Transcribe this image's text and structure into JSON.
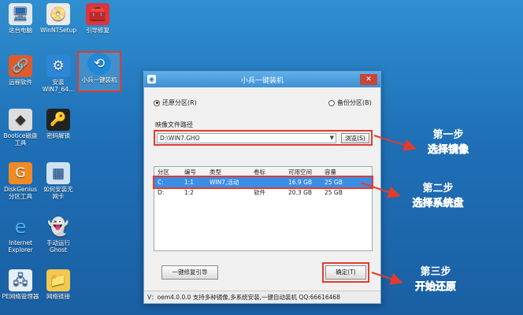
{
  "desktop": {
    "icons": [
      {
        "label": "这台电脑"
      },
      {
        "label": "WinNTSetup"
      },
      {
        "label": "引导修复"
      },
      {
        "label": "远程软件"
      },
      {
        "label": "安装\nWIN7_64..."
      },
      {
        "label": "小兵一键装机"
      },
      {
        "label": "Bootice磁盘\n工具"
      },
      {
        "label": "密码解锁"
      },
      {
        "label": "DiskGenius\n分区工具"
      },
      {
        "label": "如何安装无\n网卡"
      },
      {
        "label": "Internet\nExplorer"
      },
      {
        "label": "手动运行\nGhost"
      },
      {
        "label": "PE网络管理器"
      },
      {
        "label": "网络链接"
      }
    ]
  },
  "window": {
    "title": "小兵一键装机",
    "app_icon": "app-icon",
    "close_glyph": "✕",
    "radio_restore": "还原分区(R)",
    "radio_backup": "备份分区(B)",
    "image_path_label": "映像文件路径",
    "image_path_value": "D:\\WIN7.GHO",
    "browse_label": "浏览(S)",
    "table": {
      "headers": [
        "分区",
        "编号",
        "类型",
        "卷标",
        "可用空间",
        "容量"
      ],
      "rows": [
        [
          "C:",
          "1:1",
          "WIN7,活动",
          "",
          "16.9 GB",
          "25 GB"
        ],
        [
          "D:",
          "1:2",
          "",
          "软件",
          "20.3 GB",
          "25 GB"
        ]
      ]
    },
    "repair_button": "一键修复引导",
    "ok_button": "确定(T)",
    "status": "V：oem4.0.0.0       支持多种镜像,多系统安装,一键自动装机   QQ:66616468"
  },
  "annotations": {
    "step1_title": "第一步",
    "step1_text": "选择镜像",
    "step2_title": "第二步",
    "step2_text": "选择系统盘",
    "step3_title": "第三步",
    "step3_text": "开始还原"
  },
  "colors": {
    "highlight": "#e23b2e",
    "selection": "#3a8ee6",
    "desktop": "#1f6fb6"
  }
}
